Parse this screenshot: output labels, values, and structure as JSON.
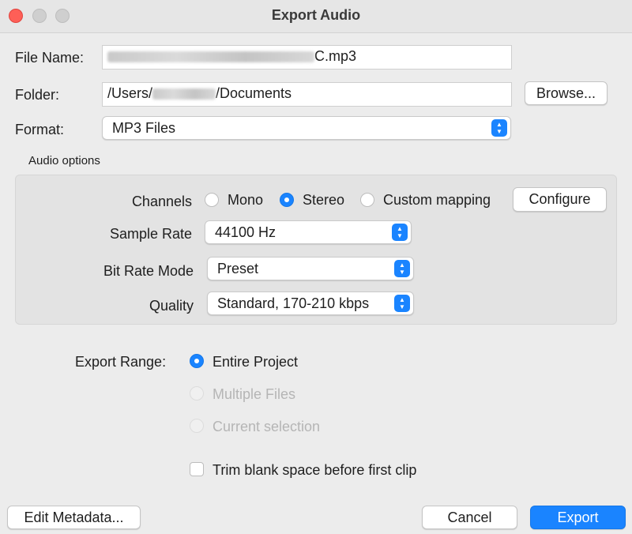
{
  "window": {
    "title": "Export Audio"
  },
  "file_name": {
    "label": "File Name:",
    "value_suffix": "C.mp3"
  },
  "folder": {
    "label": "Folder:",
    "value_prefix": "/Users/",
    "value_suffix": "/Documents",
    "browse_label": "Browse..."
  },
  "format": {
    "label": "Format:",
    "selected": "MP3 Files"
  },
  "audio_options": {
    "heading": "Audio options",
    "channels": {
      "label": "Channels",
      "options": [
        "Mono",
        "Stereo",
        "Custom mapping"
      ],
      "selected": "Stereo",
      "configure_label": "Configure"
    },
    "sample_rate": {
      "label": "Sample Rate",
      "selected": "44100 Hz"
    },
    "bit_rate_mode": {
      "label": "Bit Rate Mode",
      "selected": "Preset"
    },
    "quality": {
      "label": "Quality",
      "selected": "Standard, 170-210 kbps"
    }
  },
  "export_range": {
    "label": "Export Range:",
    "options": [
      "Entire Project",
      "Multiple Files",
      "Current selection"
    ],
    "selected": "Entire Project"
  },
  "trim": {
    "label": "Trim blank space before first clip",
    "checked": false
  },
  "footer": {
    "edit_metadata_label": "Edit Metadata...",
    "cancel_label": "Cancel",
    "export_label": "Export"
  },
  "colors": {
    "accent": "#1a84ff",
    "close": "#fe5f57",
    "window_bg": "#ececec"
  }
}
